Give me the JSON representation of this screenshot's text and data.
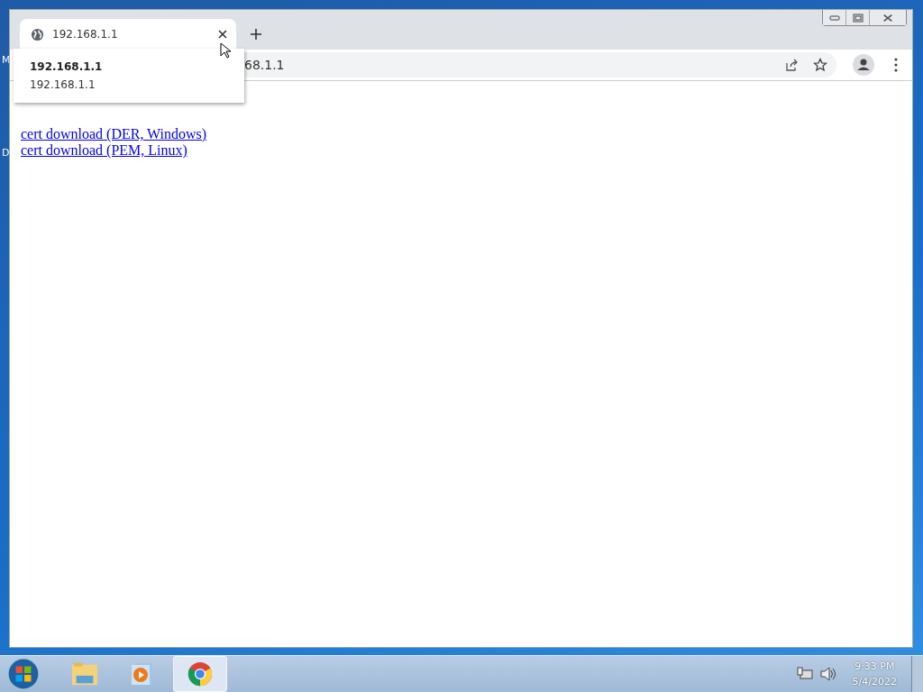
{
  "desktop": {
    "icon_labels": [
      "M",
      "D"
    ]
  },
  "browser": {
    "tab": {
      "title": "192.168.1.1",
      "selected": true
    },
    "tooltip": {
      "title": "192.168.1.1",
      "url": "192.168.1.1"
    },
    "address": "68.1.1",
    "links": [
      "cert download (DER, Windows)",
      "cert download (PEM, Linux)"
    ]
  },
  "taskbar": {
    "apps": [
      {
        "kind": "explorer",
        "selected": false
      },
      {
        "kind": "media",
        "selected": false
      },
      {
        "kind": "chrome",
        "selected": true
      }
    ],
    "clock": {
      "time": "9:33 PM",
      "date": "5/4/2022"
    }
  }
}
